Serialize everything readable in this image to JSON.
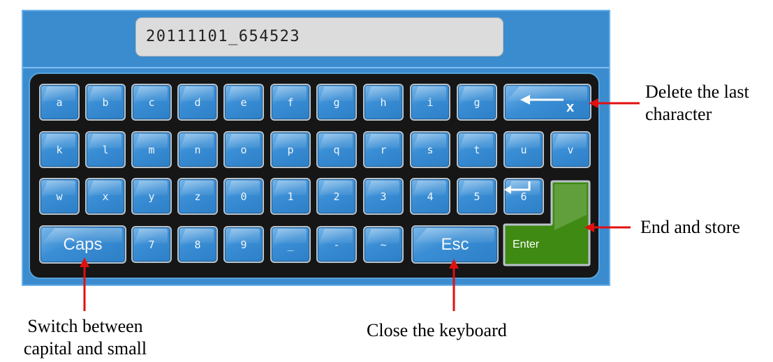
{
  "input": {
    "value": "20111101_654523"
  },
  "keyboard": {
    "row1": [
      "a",
      "b",
      "c",
      "d",
      "e",
      "f",
      "g",
      "h",
      "i",
      "g"
    ],
    "row2": [
      "k",
      "l",
      "m",
      "n",
      "o",
      "p",
      "q",
      "r",
      "s",
      "t",
      "u",
      "v"
    ],
    "row3": [
      "w",
      "x",
      "y",
      "z",
      "0",
      "1",
      "2",
      "3",
      "4",
      "5",
      "6"
    ],
    "row4": [
      "7",
      "8",
      "9",
      "_",
      "-",
      "~"
    ],
    "caps_label": "Caps",
    "esc_label": "Esc",
    "enter_label": "Enter",
    "backspace_mark": "x"
  },
  "annotations": {
    "delete_line1": "Delete the last",
    "delete_line2": "character",
    "enter": "End and store",
    "caps_line1": "Switch between",
    "caps_line2": "capital and small",
    "esc": "Close the keyboard"
  },
  "colors": {
    "panel": "#3b8cce",
    "key": "#3a8ed5",
    "enter_key": "#3f8a12",
    "arrow": "#e01010"
  }
}
